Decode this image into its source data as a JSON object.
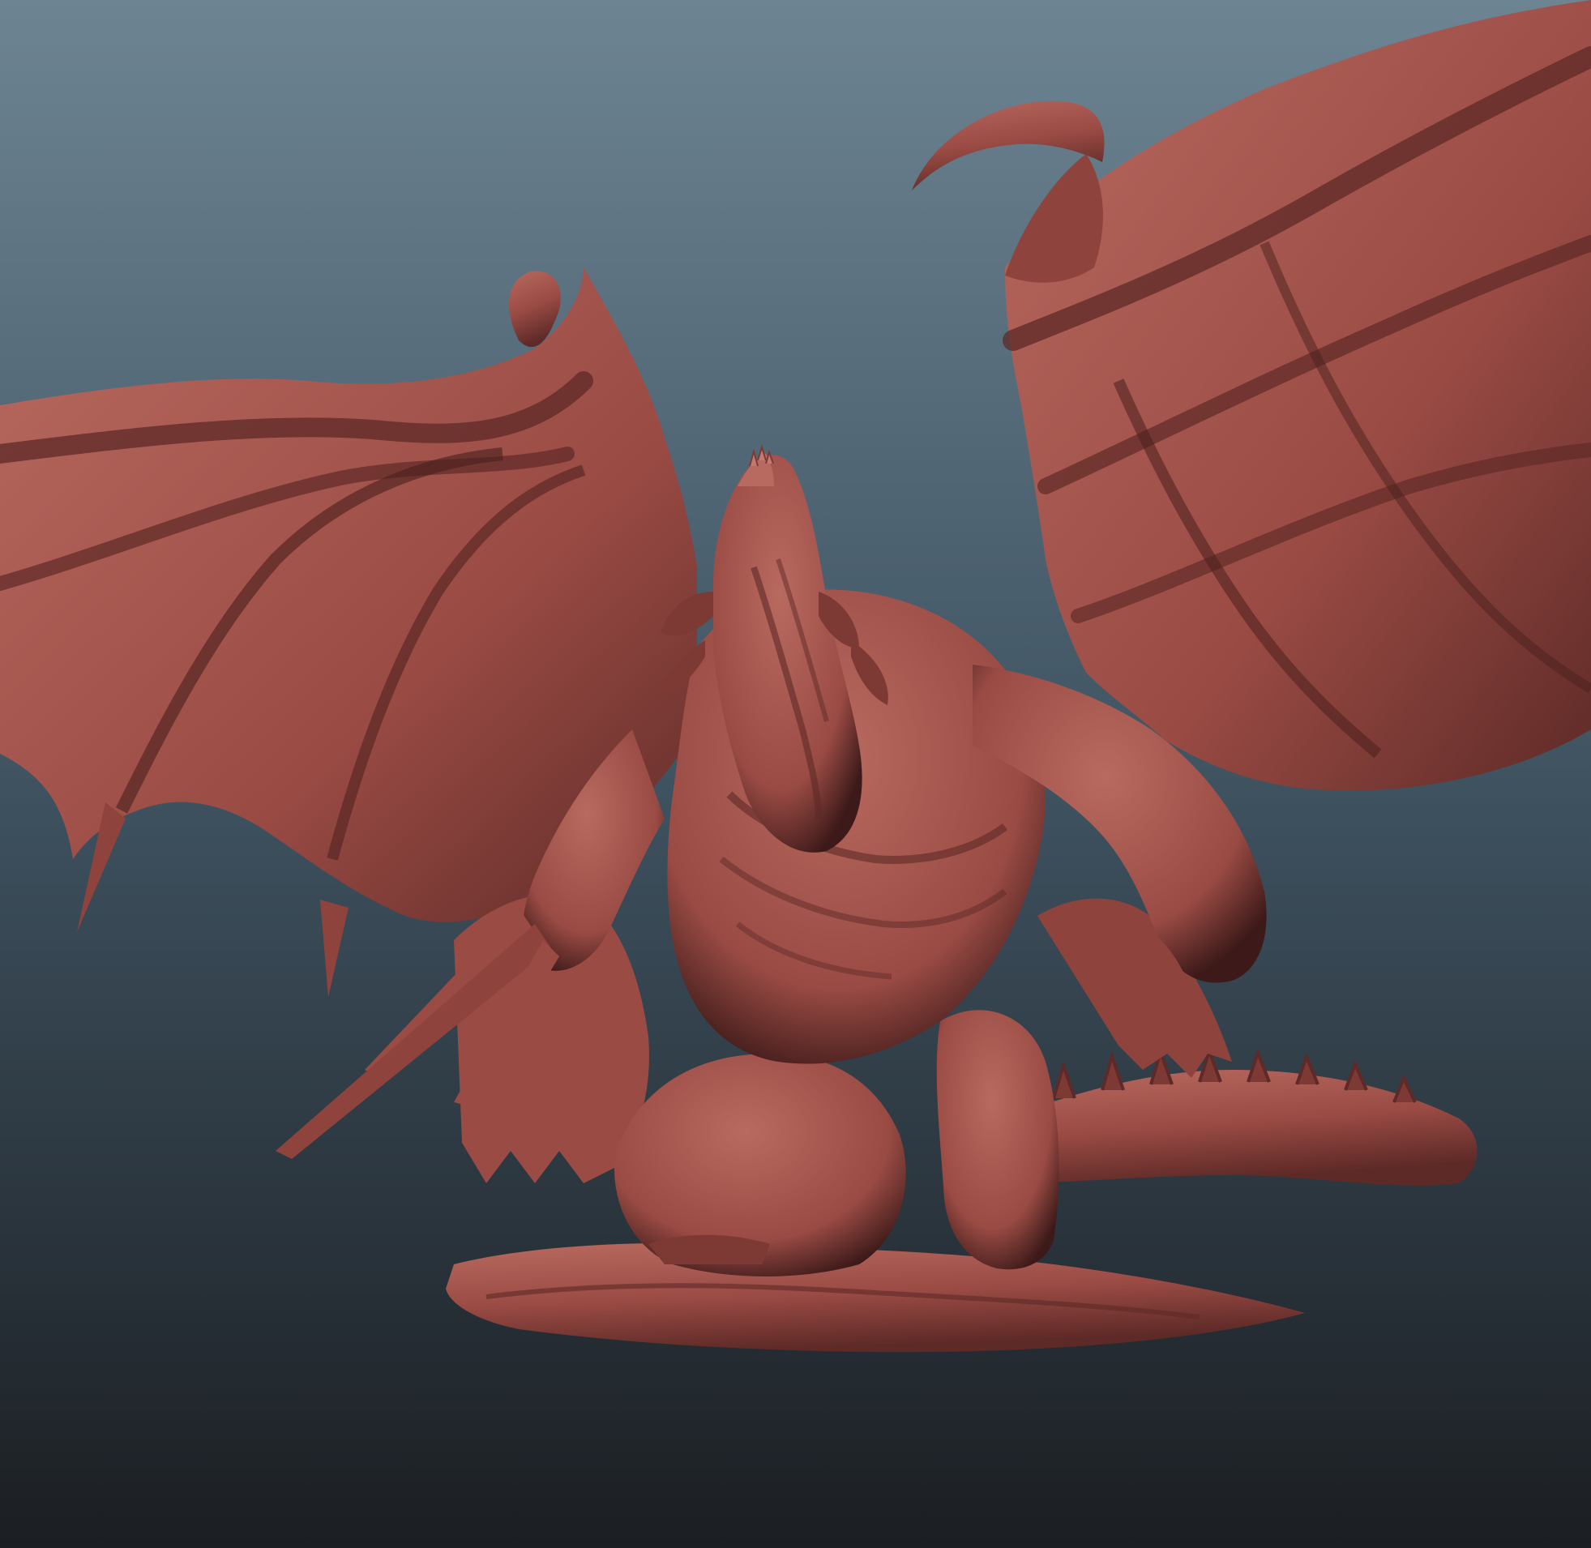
{
  "scene": {
    "subject": "dragon-sculpt",
    "colors": {
      "background_top": "#6d8493",
      "background_mid": "#3f5361",
      "background_bottom": "#1b1e22",
      "clay_light": "#b86a60",
      "clay_mid": "#9a4b44",
      "clay_dark": "#5e2a27",
      "clay_shadow": "#3d1a19"
    }
  }
}
